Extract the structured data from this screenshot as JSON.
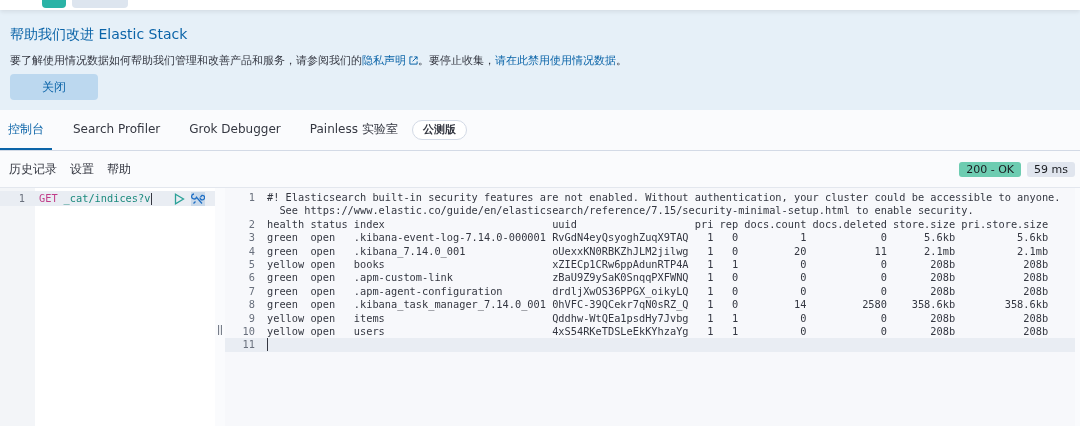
{
  "banner": {
    "title": "帮助我们改进 Elastic Stack",
    "text_before": "要了解使用情况数据如何帮助我们管理和改善产品和服务，请参阅我们的",
    "privacy_link": "隐私声明",
    "text_middle": "。要停止收集，",
    "disable_link": "请在此禁用使用情况数据",
    "text_after": "。",
    "close_button": "关闭"
  },
  "tabs": [
    {
      "label": "控制台",
      "selected": true
    },
    {
      "label": "Search Profiler",
      "selected": false
    },
    {
      "label": "Grok Debugger",
      "selected": false
    },
    {
      "label": "Painless 实验室",
      "selected": false,
      "badge": "公测版"
    }
  ],
  "toolbar": {
    "links": [
      "历史记录",
      "设置",
      "帮助"
    ],
    "status": "200 - OK",
    "duration": "59 ms"
  },
  "request": {
    "lines": [
      {
        "number": "1",
        "method": "GET",
        "path": "_cat/indices?v",
        "active": true
      }
    ]
  },
  "response": {
    "lines": [
      {
        "number": "1",
        "rows": [
          "#! Elasticsearch built-in security features are not enabled. Without authentication, your cluster could be accessible to anyone.",
          "  See https://www.elastic.co/guide/en/elasticsearch/reference/7.15/security-minimal-setup.html to enable security."
        ],
        "active": false
      },
      {
        "number": "2",
        "rows": [
          "health status index                           uuid                   pri rep docs.count docs.deleted store.size pri.store.size"
        ],
        "active": false
      },
      {
        "number": "3",
        "rows": [
          "green  open   .kibana-event-log-7.14.0-000001 RvGdN4eyQsyoghZuqX9TAQ   1   0          1            0      5.6kb          5.6kb"
        ],
        "active": false
      },
      {
        "number": "4",
        "rows": [
          "green  open   .kibana_7.14.0_001              oUexxKN0RBKZhJLM2jilwg   1   0         20           11      2.1mb          2.1mb"
        ],
        "active": false
      },
      {
        "number": "5",
        "rows": [
          "yellow open   books                           xZIECp1CRw6ppAdunRTP4A   1   1          0            0       208b           208b"
        ],
        "active": false
      },
      {
        "number": "6",
        "rows": [
          "green  open   .apm-custom-link                zBaU9Z9ySaK0SnqqPXFWNQ   1   0          0            0       208b           208b"
        ],
        "active": false
      },
      {
        "number": "7",
        "rows": [
          "green  open   .apm-agent-configuration        drdljXwOS36PPGX_oikyLQ   1   0          0            0       208b           208b"
        ],
        "active": false
      },
      {
        "number": "8",
        "rows": [
          "green  open   .kibana_task_manager_7.14.0_001 0hVFC-39QCekr7qN0sRZ_Q   1   0         14         2580    358.6kb        358.6kb"
        ],
        "active": false
      },
      {
        "number": "9",
        "rows": [
          "yellow open   items                           Qddhw-WtQEa1psdHy7Jvbg   1   1          0            0       208b           208b"
        ],
        "active": false
      },
      {
        "number": "10",
        "rows": [
          "yellow open   users                           4xS54RKeTDSLeEkKYhzaYg   1   1          0            0       208b           208b"
        ],
        "active": false
      },
      {
        "number": "11",
        "active": true
      }
    ]
  }
}
